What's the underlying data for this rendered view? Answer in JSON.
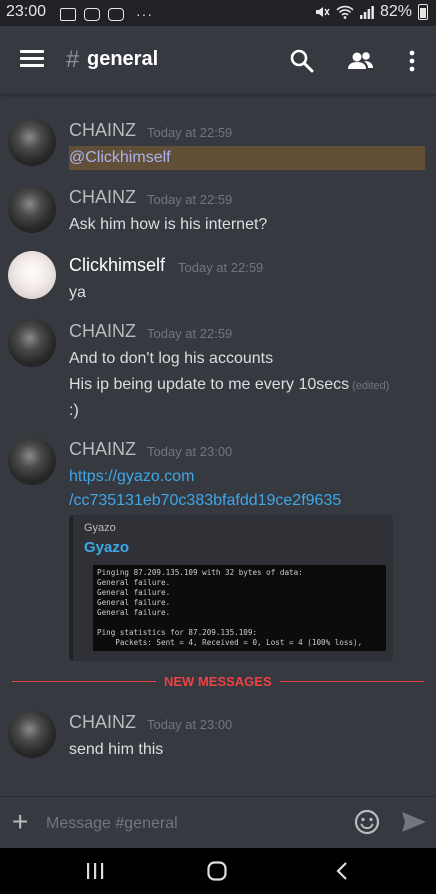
{
  "status_bar": {
    "time": "23:00",
    "battery": "82%",
    "dots": "···"
  },
  "header": {
    "hash": "#",
    "channel_name": "general"
  },
  "messages": [
    {
      "author": "CHAINZ",
      "timestamp": "Today at 22:59",
      "mention": "@Clickhimself"
    },
    {
      "author": "CHAINZ",
      "timestamp": "Today at 22:59",
      "lines": [
        "Ask him how is his internet?"
      ]
    },
    {
      "author": "Clickhimself",
      "timestamp": "Today at 22:59",
      "lines": [
        "ya"
      ]
    },
    {
      "author": "CHAINZ",
      "timestamp": "Today at 22:59",
      "lines": [
        "And to don't log his accounts",
        "His ip being update to me every 10secs",
        ":)"
      ],
      "edited": "(edited)"
    },
    {
      "author": "CHAINZ",
      "timestamp": "Today at 23:00",
      "link_lines": [
        "https://gyazo.com",
        "/cc735131eb70c383bfafdd19ce2f9635"
      ]
    },
    {
      "author": "CHAINZ",
      "timestamp": "Today at 23:00",
      "lines": [
        "send him this"
      ]
    }
  ],
  "embed": {
    "provider": "Gyazo",
    "title": "Gyazo",
    "image_text": "Pinging 87.209.135.109 with 32 bytes of data:\nGeneral failure.\nGeneral failure.\nGeneral failure.\nGeneral failure.\n\nPing statistics for 87.209.135.109:\n    Packets: Sent = 4, Received = 0, Lost = 4 (100% loss),"
  },
  "divider": {
    "label": "NEW MESSAGES"
  },
  "composer": {
    "placeholder": "Message #general",
    "plus": "+"
  },
  "colors": {
    "background": "#36393f",
    "link": "#3fa7e8",
    "mention": "#a8b4f0",
    "new_messages": "#ed4245"
  }
}
